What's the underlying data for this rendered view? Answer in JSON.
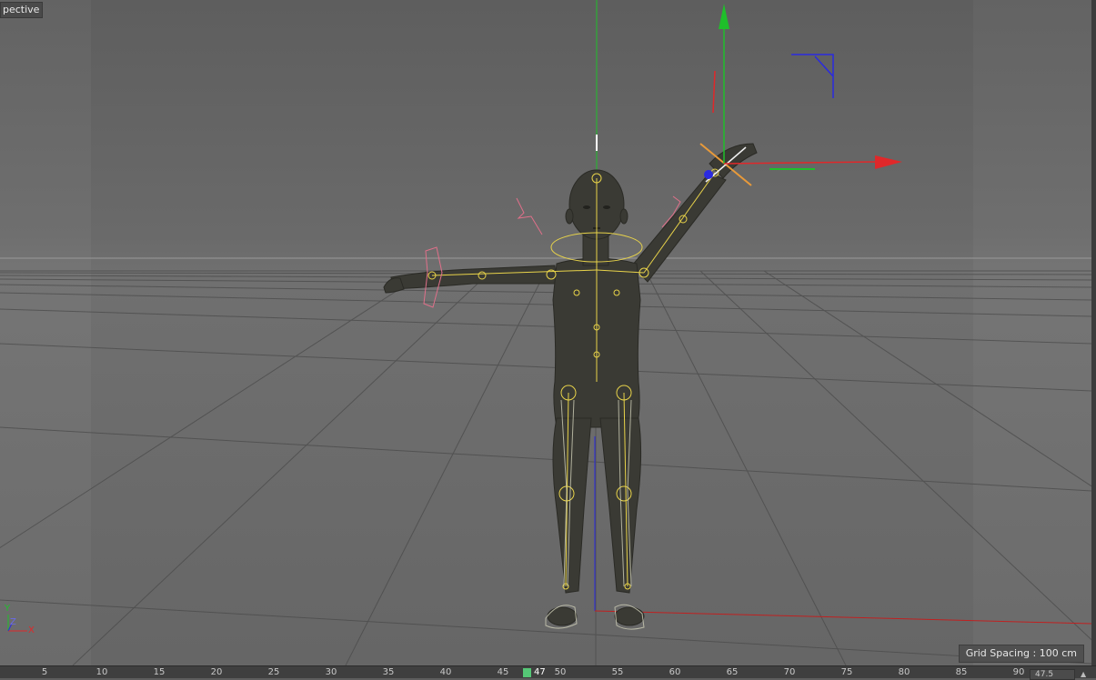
{
  "viewport": {
    "label": "pective",
    "grid_spacing": "Grid Spacing : 100 cm",
    "axis_labels": {
      "y": "Y",
      "z": "Z",
      "x": "X"
    },
    "colors": {
      "axis_x": "#e0282a",
      "axis_y": "#1fbf2a",
      "axis_z": "#2a2ae0",
      "joint": "#e8d34a",
      "ik_goal": "#e0708a",
      "figure_body": "#3a3a34"
    },
    "icons": [
      "move-tool-gizmo",
      "axis-orientation-widget"
    ]
  },
  "timeline": {
    "ticks": [
      "5",
      "10",
      "15",
      "20",
      "25",
      "30",
      "35",
      "40",
      "45",
      "50",
      "55",
      "60",
      "65",
      "70",
      "75",
      "80",
      "85",
      "90"
    ],
    "current_frame": "47",
    "frame_field": "47.5"
  }
}
